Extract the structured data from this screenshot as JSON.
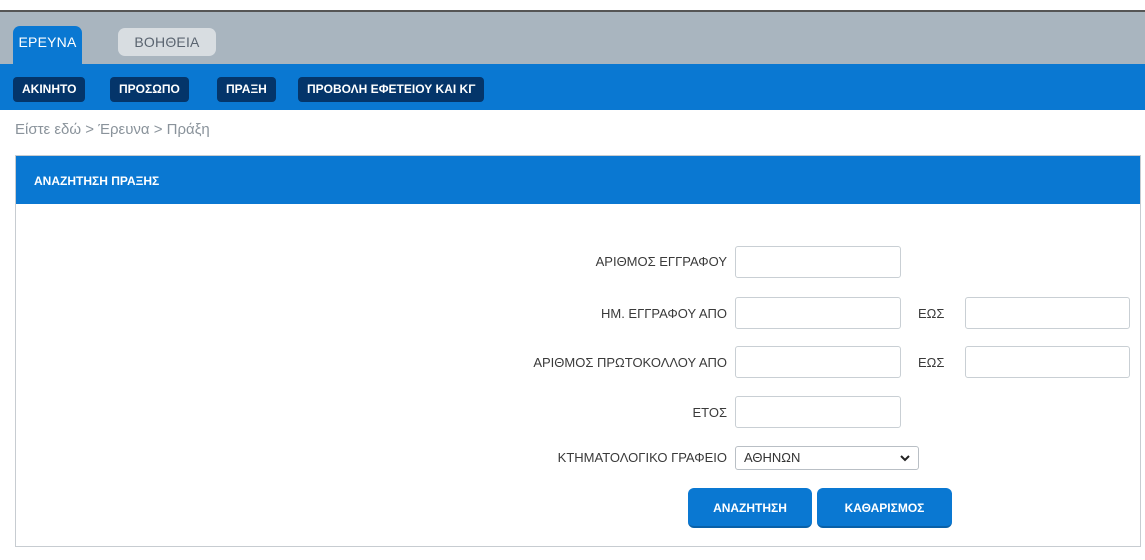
{
  "tabs": [
    {
      "label": "ΕΡΕΥΝΑ",
      "active": true
    },
    {
      "label": "ΒΟΗΘΕΙΑ",
      "active": false
    }
  ],
  "menu": [
    {
      "label": "ΑΚΙΝΗΤΟ"
    },
    {
      "label": "ΠΡΟΣΩΠΟ"
    },
    {
      "label": "ΠΡΑΞΗ"
    },
    {
      "label": "ΠΡΟΒΟΛΗ ΕΦΕΤΕΙΟΥ ΚΑΙ ΚΓ"
    }
  ],
  "breadcrumb": "Είστε εδώ > Έρευνα > Πράξη",
  "panel": {
    "title": "ΑΝΑΖΗΤΗΣΗ ΠΡΑΞΗΣ"
  },
  "form": {
    "doc_number": {
      "label": "ΑΡΙΘΜΟΣ ΕΓΓΡΑΦΟΥ",
      "value": ""
    },
    "doc_date": {
      "label": "ΗΜ. ΕΓΓΡΑΦΟΥ ΑΠΟ",
      "to_label": "ΕΩΣ",
      "from_value": "",
      "to_value": ""
    },
    "protocol": {
      "label": "ΑΡΙΘΜΟΣ ΠΡΩΤΟΚΟΛΛΟΥ ΑΠΟ",
      "to_label": "ΕΩΣ",
      "from_value": "",
      "to_value": ""
    },
    "year": {
      "label": "ΕΤΟΣ",
      "value": ""
    },
    "office": {
      "label": "ΚΤΗΜΑΤΟΛΟΓΙΚΟ ΓΡΑΦΕΙΟ",
      "selected": "ΑΘΗΝΩΝ"
    }
  },
  "buttons": {
    "search": "ΑΝΑΖΗΤΗΣΗ",
    "clear": "ΚΑΘΑΡΙΣΜΟΣ"
  },
  "colors": {
    "primary": "#0a78d2",
    "menu_button": "#04356a",
    "tab_bar": "#a9b5bf"
  }
}
